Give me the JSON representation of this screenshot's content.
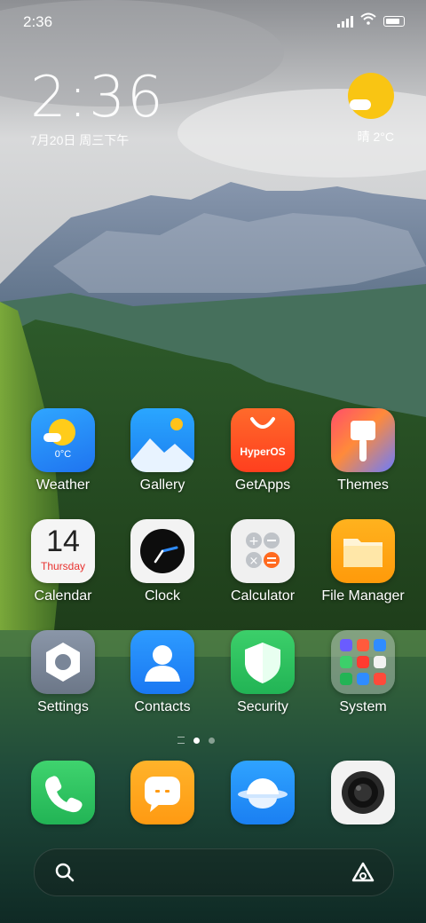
{
  "status_bar": {
    "time": "2:36"
  },
  "clock_widget": {
    "time": "2:36",
    "date": "7月20日 周三下午"
  },
  "weather_widget": {
    "condition": "晴 2°C"
  },
  "apps": [
    {
      "label": "Weather",
      "icon": "weather-icon",
      "badge": "0°C"
    },
    {
      "label": "Gallery",
      "icon": "gallery-icon"
    },
    {
      "label": "GetApps",
      "icon": "getapps-icon",
      "badge": "HyperOS"
    },
    {
      "label": "Themes",
      "icon": "themes-icon"
    },
    {
      "label": "Calendar",
      "icon": "calendar-icon",
      "day": "14",
      "weekday": "Thursday"
    },
    {
      "label": "Clock",
      "icon": "clock-icon"
    },
    {
      "label": "Calculator",
      "icon": "calculator-icon"
    },
    {
      "label": "File Manager",
      "icon": "file-manager-icon"
    },
    {
      "label": "Settings",
      "icon": "settings-icon"
    },
    {
      "label": "Contacts",
      "icon": "contacts-icon"
    },
    {
      "label": "Security",
      "icon": "security-icon"
    },
    {
      "label": "System",
      "icon": "folder-icon"
    }
  ],
  "dock": [
    {
      "name": "phone",
      "icon": "phone-icon"
    },
    {
      "name": "messages",
      "icon": "messages-icon"
    },
    {
      "name": "browser",
      "icon": "browser-icon"
    },
    {
      "name": "camera",
      "icon": "camera-icon"
    }
  ],
  "pager": {
    "pages": 2,
    "current": 1
  },
  "search_bar": {
    "left_icon": "search-icon",
    "right_icon": "assistant-icon"
  }
}
